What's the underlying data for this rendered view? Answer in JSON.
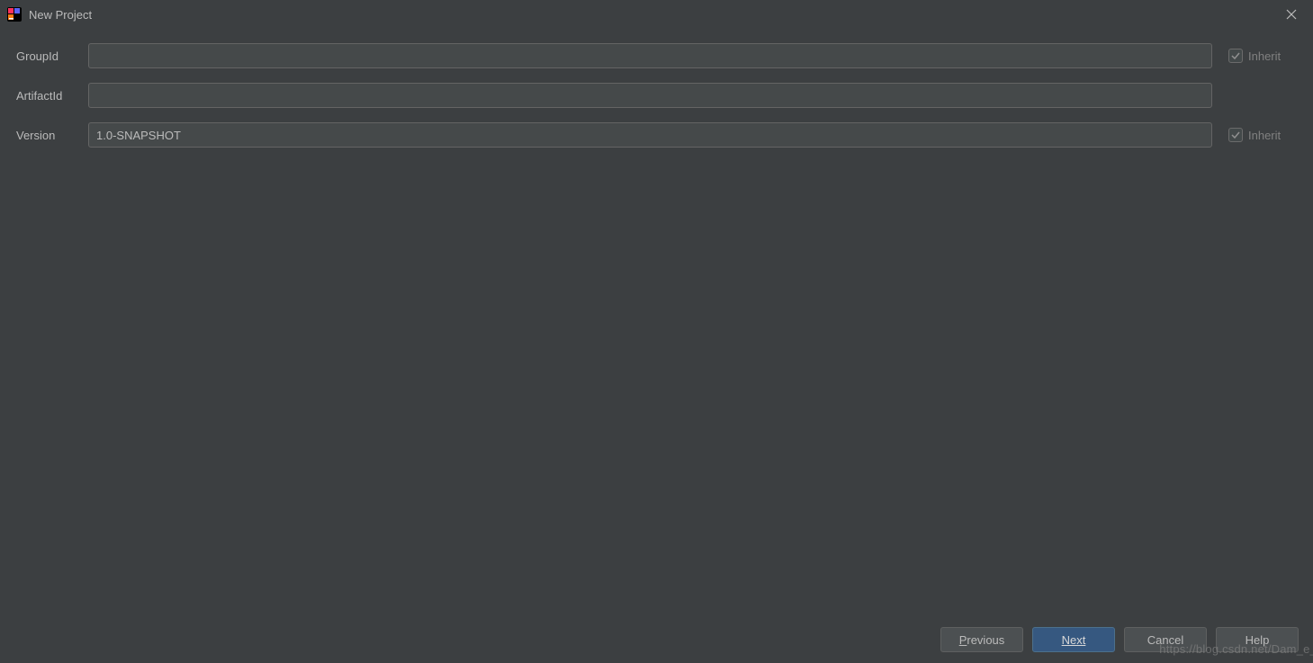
{
  "window": {
    "title": "New Project"
  },
  "form": {
    "groupId": {
      "label": "GroupId",
      "value": "",
      "inherit_label": "Inherit",
      "inherit_checked": true
    },
    "artifactId": {
      "label": "ArtifactId",
      "value": ""
    },
    "version": {
      "label": "Version",
      "value": "1.0-SNAPSHOT",
      "inherit_label": "Inherit",
      "inherit_checked": true
    }
  },
  "buttons": {
    "previous": "Previous",
    "next": "Next",
    "cancel": "Cancel",
    "help": "Help"
  },
  "watermark": "https://blog.csdn.net/Dam_e_"
}
